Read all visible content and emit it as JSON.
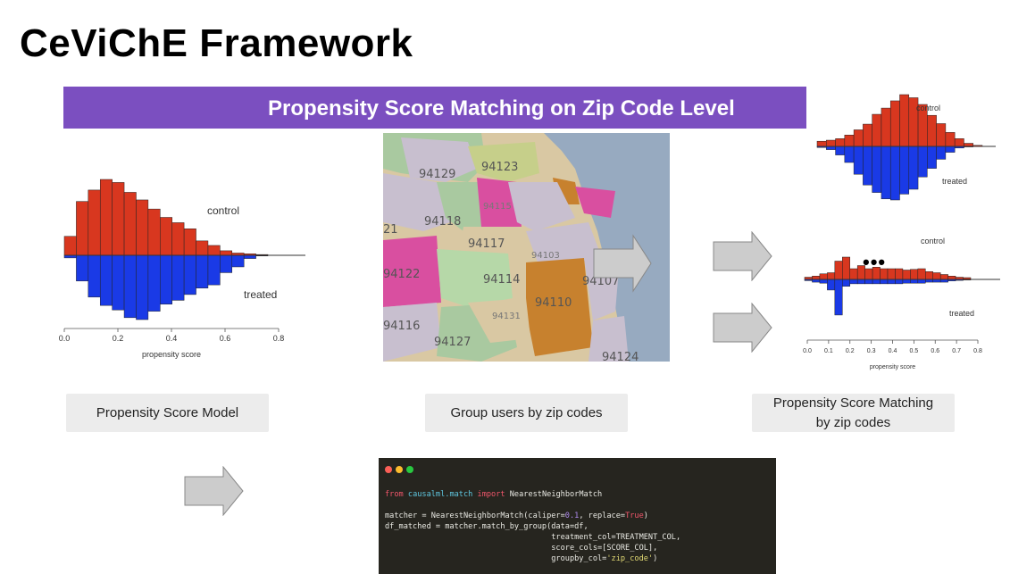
{
  "slide": {
    "title": "CeViChE Framework",
    "banner": "Propensity Score Matching on Zip Code Level",
    "colors": {
      "banner": "#7b4fc0",
      "control": "#d8371f",
      "treated": "#1a3ae6"
    },
    "ellipsis": "•••"
  },
  "captions": {
    "model": "Propensity Score Model",
    "group": "Group users by zip codes",
    "matching_line1": "Propensity Score Matching",
    "matching_line2": "by zip codes"
  },
  "map": {
    "zip_labels": [
      "94129",
      "94123",
      "94115",
      "94118",
      "94117",
      "94103",
      "94114",
      "94110",
      "94107",
      "94122",
      "94131",
      "94116",
      "94127",
      "94124",
      "21"
    ]
  },
  "code": {
    "line1": {
      "from": "from",
      "module": "causalml.match",
      "import": "import",
      "name": "NearestNeighborMatch"
    },
    "line2": {
      "pre": "matcher = NearestNeighborMatch(caliper=",
      "caliper": "0.1",
      "mid": ", replace=",
      "replace": "True",
      "post": ")"
    },
    "line3": "df_matched = matcher.match_by_group(data=df,",
    "line4": "                                    treatment_col=TREATMENT_COL,",
    "line5": "                                    score_cols=[SCORE_COL],",
    "line6": {
      "pre": "                                    groupby_col=",
      "value": "'zip_code'",
      "post": ")"
    }
  },
  "chart_data": [
    {
      "type": "bar",
      "title": "",
      "xlabel": "propensity score",
      "ylabel": "",
      "xlim": [
        0.0,
        0.8
      ],
      "xticks": [
        "0.0",
        "0.2",
        "0.4",
        "0.6",
        "0.8"
      ],
      "bin_width": 0.033,
      "x_start": 0.0,
      "series": [
        {
          "name": "control",
          "values": [
            0.25,
            0.71,
            0.86,
            1.0,
            0.96,
            0.83,
            0.73,
            0.61,
            0.5,
            0.43,
            0.35,
            0.19,
            0.13,
            0.06,
            0.03,
            0.02,
            0.01
          ]
        },
        {
          "name": "treated",
          "values": [
            0.04,
            0.4,
            0.65,
            0.78,
            0.85,
            0.97,
            1.0,
            0.87,
            0.76,
            0.7,
            0.61,
            0.51,
            0.46,
            0.27,
            0.18,
            0.05,
            0.01
          ]
        }
      ]
    },
    {
      "type": "bar",
      "title": "",
      "xlabel": "",
      "ylabel": "",
      "series": [
        {
          "name": "control",
          "values": [
            0.1,
            0.12,
            0.15,
            0.22,
            0.32,
            0.43,
            0.62,
            0.74,
            0.88,
            1.0,
            0.94,
            0.81,
            0.6,
            0.44,
            0.27,
            0.15,
            0.06,
            0.02
          ]
        },
        {
          "name": "treated",
          "values": [
            0.02,
            0.06,
            0.16,
            0.3,
            0.52,
            0.72,
            0.86,
            0.98,
            1.0,
            0.89,
            0.8,
            0.57,
            0.41,
            0.24,
            0.11,
            0.03,
            0.01,
            0.0
          ]
        }
      ]
    },
    {
      "type": "bar",
      "title": "",
      "xlabel": "propensity score",
      "ylabel": "",
      "xlim": [
        0.0,
        0.8
      ],
      "xticks": [
        "0.0",
        "0.1",
        "0.2",
        "0.3",
        "0.4",
        "0.5",
        "0.6",
        "0.7",
        "0.8"
      ],
      "series": [
        {
          "name": "control",
          "values": [
            0.1,
            0.15,
            0.25,
            0.3,
            0.82,
            1.0,
            0.48,
            0.62,
            0.48,
            0.55,
            0.48,
            0.48,
            0.48,
            0.42,
            0.45,
            0.48,
            0.35,
            0.3,
            0.22,
            0.15,
            0.1,
            0.08
          ]
        },
        {
          "name": "treated",
          "values": [
            0.1,
            0.22,
            0.3,
            0.85,
            2.85,
            0.55,
            0.35,
            0.35,
            0.35,
            0.35,
            0.35,
            0.35,
            0.35,
            0.3,
            0.3,
            0.3,
            0.22,
            0.22,
            0.22,
            0.12,
            0.08,
            0.05
          ]
        }
      ]
    }
  ]
}
